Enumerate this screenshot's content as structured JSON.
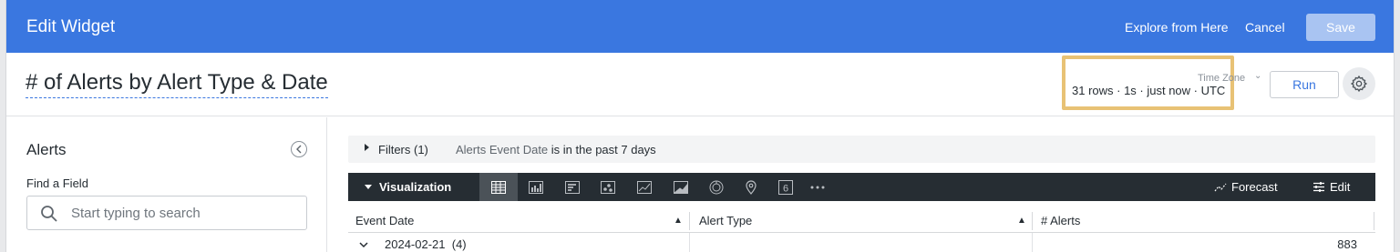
{
  "header": {
    "title": "Edit Widget",
    "explore_label": "Explore from Here",
    "cancel_label": "Cancel",
    "save_label": "Save"
  },
  "widget": {
    "title": "# of Alerts by Alert Type & Date",
    "timezone_label": "Time Zone",
    "stats": "31 rows · 1s · just now · UTC",
    "run_label": "Run"
  },
  "sidebar": {
    "explore_name": "Alerts",
    "find_field_label": "Find a Field",
    "search_placeholder": "Start typing to search"
  },
  "filters": {
    "label": "Filters (1)",
    "field": "Alerts Event Date",
    "condition": "is in the past 7 days"
  },
  "visualization": {
    "label": "Visualization",
    "forecast_label": "Forecast",
    "edit_label": "Edit",
    "number_icon_text": "6",
    "types": [
      "table",
      "column",
      "bar",
      "scatter",
      "line",
      "area",
      "pie",
      "map",
      "single-value",
      "more"
    ]
  },
  "table": {
    "columns": [
      "Event Date",
      "Alert Type",
      "# Alerts"
    ],
    "rows": [
      {
        "date": "2024-02-21",
        "count_label": "(4)",
        "alert_type": "",
        "alerts": "883"
      }
    ]
  },
  "colors": {
    "primary": "#3a77e0",
    "save_disabled": "#a9c4f2",
    "viz_bar": "#262d33",
    "highlight": "#e8c275"
  }
}
